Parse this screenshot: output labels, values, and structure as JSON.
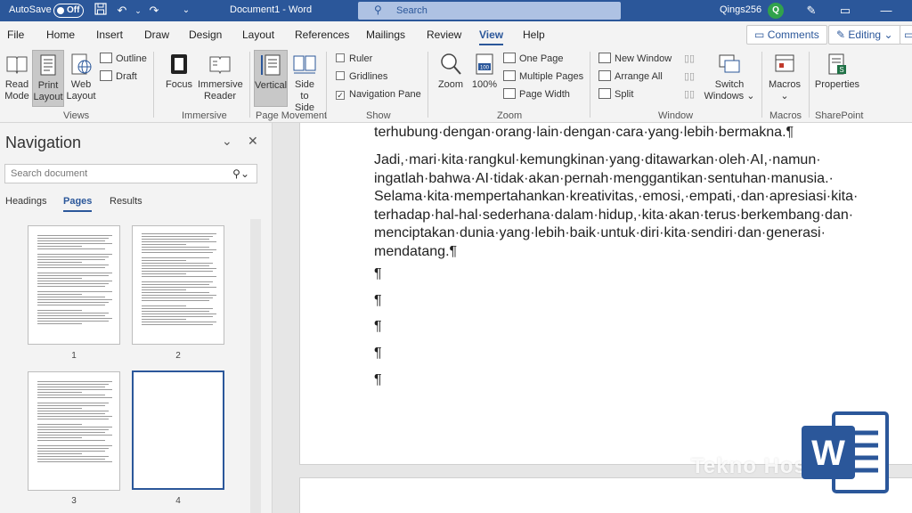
{
  "titlebar": {
    "autosave_label": "AutoSave",
    "autosave_state": "Off",
    "document_title": "Document1 - Word",
    "search_placeholder": "Search",
    "user_name": "Qings256",
    "avatar_initial": "Q"
  },
  "menu": {
    "tabs": [
      "File",
      "Home",
      "Insert",
      "Draw",
      "Design",
      "Layout",
      "References",
      "Mailings",
      "Review",
      "View",
      "Help"
    ],
    "active_tab": "View",
    "comments_label": "Comments",
    "editing_label": "Editing"
  },
  "ribbon": {
    "views": {
      "read_mode": [
        "Read",
        "Mode"
      ],
      "print_layout": [
        "Print",
        "Layout"
      ],
      "web_layout": [
        "Web",
        "Layout"
      ],
      "outline": "Outline",
      "draft": "Draft",
      "group_label": "Views"
    },
    "immersive": {
      "focus": "Focus",
      "immersive_reader": [
        "Immersive",
        "Reader"
      ],
      "group_label": "Immersive"
    },
    "page_movement": {
      "vertical": "Vertical",
      "side_to_side": [
        "Side",
        "to Side"
      ],
      "group_label": "Page Movement"
    },
    "show": {
      "ruler": "Ruler",
      "gridlines": "Gridlines",
      "navigation_pane": "Navigation Pane",
      "ruler_checked": false,
      "gridlines_checked": false,
      "navigation_pane_checked": true,
      "group_label": "Show"
    },
    "zoom": {
      "zoom": "Zoom",
      "zoom_100": "100%",
      "one_page": "One Page",
      "multiple_pages": "Multiple Pages",
      "page_width": "Page Width",
      "group_label": "Zoom"
    },
    "window": {
      "new_window": "New Window",
      "arrange_all": "Arrange All",
      "split": "Split",
      "switch_windows": [
        "Switch",
        "Windows"
      ],
      "group_label": "Window"
    },
    "macros": {
      "macros": "Macros",
      "group_label": "Macros"
    },
    "sharepoint": {
      "properties": "Properties",
      "group_label": "SharePoint"
    }
  },
  "navigation": {
    "title": "Navigation",
    "search_placeholder": "Search document",
    "tabs": [
      "Headings",
      "Pages",
      "Results"
    ],
    "active_tab": "Pages",
    "page_numbers": [
      "1",
      "2",
      "3",
      "4"
    ],
    "selected_page": "4"
  },
  "document": {
    "paragraph_top": "terhubung·dengan·orang·lain·dengan·cara·yang·lebih·bermakna.¶",
    "paragraph_lines": [
      "Jadi,·mari·kita·rangkul·kemungkinan·yang·ditawarkan·oleh·AI,·namun·",
      "ingatlah·bahwa·AI·tidak·akan·pernah·menggantikan·sentuhan·manusia.·",
      "Selama·kita·mempertahankan·kreativitas,·emosi,·empati,·dan·apresiasi·kita·",
      "terhadap·hal-hal·sederhana·dalam·hidup,·kita·akan·terus·berkembang·dan·",
      "menciptakan·dunia·yang·lebih·baik·untuk·diri·kita·sendiri·dan·generasi·",
      "mendatang.¶"
    ],
    "empty_paragraphs": [
      "¶",
      "¶",
      "¶",
      "¶",
      "¶"
    ]
  },
  "branding": {
    "watermark": "Tekno Hosnews",
    "logo_letter": "W",
    "logo_color": "#2b579a"
  },
  "colors": {
    "accent": "#2b579a",
    "titlebar_bg": "#2b579a",
    "ribbon_bg": "#f3f3f3"
  }
}
